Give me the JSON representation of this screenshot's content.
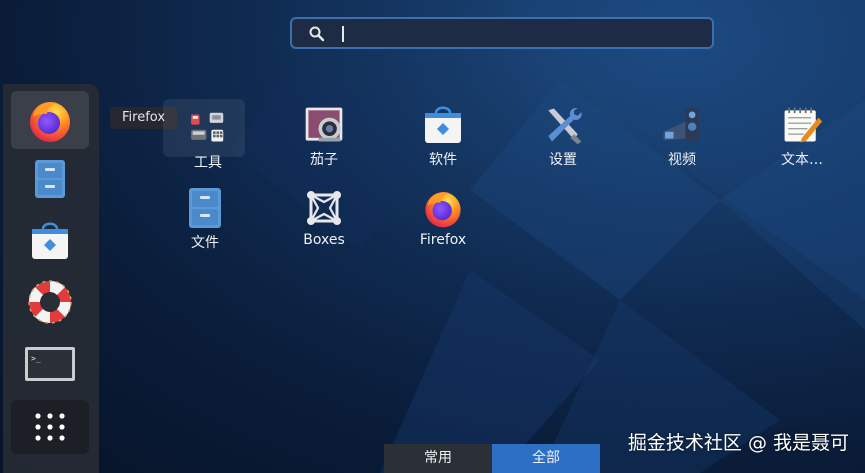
{
  "search": {
    "value": "",
    "placeholder": ""
  },
  "tooltip": {
    "text": "Firefox"
  },
  "dash": {
    "items": [
      {
        "name": "Firefox",
        "icon": "firefox-icon"
      },
      {
        "name": "文件",
        "icon": "file-cabinet-icon"
      },
      {
        "name": "软件",
        "icon": "software-bag-icon"
      },
      {
        "name": "帮助",
        "icon": "lifebuoy-icon"
      },
      {
        "name": "终端",
        "icon": "terminal-icon"
      },
      {
        "name": "显示应用程序",
        "icon": "app-grid-icon"
      }
    ]
  },
  "apps": {
    "row1": [
      {
        "label": "工具",
        "icon": "utilities-folder-icon"
      },
      {
        "label": "茄子",
        "icon": "cheese-camera-icon"
      },
      {
        "label": "软件",
        "icon": "software-bag-icon"
      },
      {
        "label": "设置",
        "icon": "settings-tools-icon"
      },
      {
        "label": "视频",
        "icon": "video-projector-icon"
      },
      {
        "label": "文本…",
        "icon": "text-editor-icon"
      }
    ],
    "row2": [
      {
        "label": "文件",
        "icon": "file-cabinet-icon"
      },
      {
        "label": "Boxes",
        "icon": "boxes-icon"
      },
      {
        "label": "Firefox",
        "icon": "firefox-icon"
      }
    ]
  },
  "tabs": {
    "frequent": "常用",
    "all": "全部"
  },
  "watermark": "掘金技术社区 @ 我是聂可"
}
